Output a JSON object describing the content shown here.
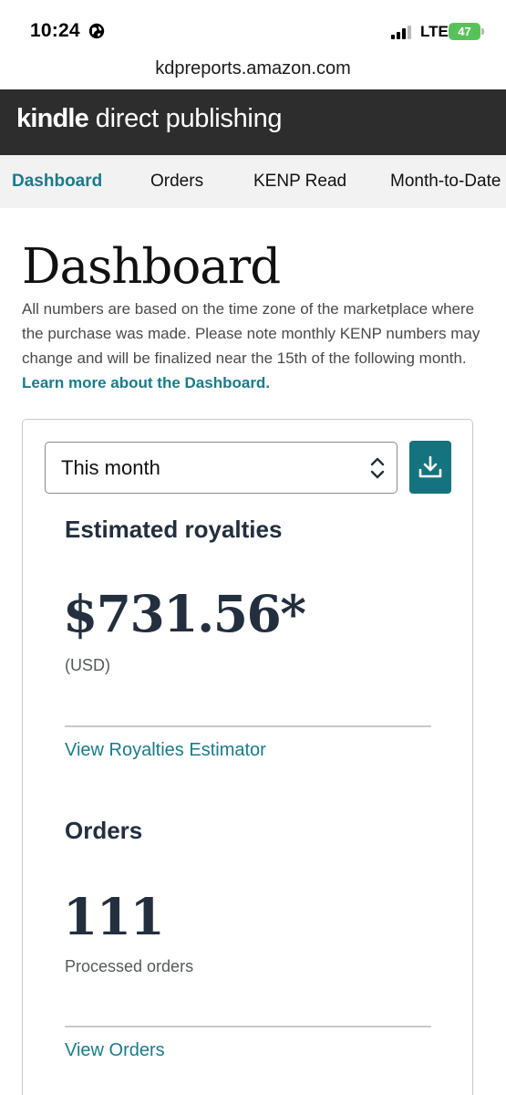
{
  "status_bar": {
    "time": "10:24",
    "network": "LTE",
    "battery": "47"
  },
  "browser": {
    "url": "kdpreports.amazon.com"
  },
  "header": {
    "logo_bold": "kindle",
    "logo_rest": " direct publishing"
  },
  "nav": {
    "tabs": [
      {
        "label": "Dashboard",
        "active": true
      },
      {
        "label": "Orders",
        "active": false
      },
      {
        "label": "KENP Read",
        "active": false
      },
      {
        "label": "Month-to-Date",
        "active": false
      }
    ]
  },
  "page": {
    "title": "Dashboard",
    "intro": "All numbers are based on the time zone of the marketplace where the purchase was made. Please note monthly KENP numbers may change and will be finalized near the 15th of the following month. ",
    "learn_more": "Learn more about the Dashboard."
  },
  "card": {
    "period": "This month",
    "royalties": {
      "title": "Estimated royalties",
      "amount": "$731.56*",
      "currency": "(USD)",
      "link": "View Royalties Estimator"
    },
    "orders": {
      "title": "Orders",
      "count": "111",
      "caption": "Processed orders",
      "link": "View Orders"
    }
  },
  "colors": {
    "accent": "#1a7b8a",
    "header_bg": "#2d2d2d",
    "heading": "#232f3e",
    "battery": "#58c25a"
  }
}
